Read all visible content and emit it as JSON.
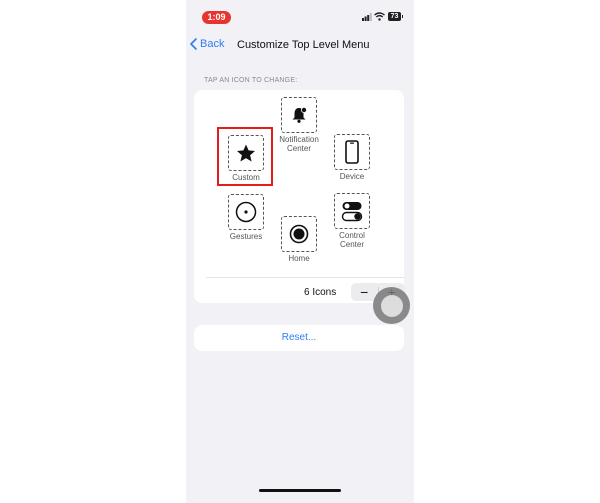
{
  "status_bar": {
    "time": "1:09",
    "battery": "73"
  },
  "nav": {
    "back_label": "Back",
    "title": "Customize Top Level Menu"
  },
  "section": {
    "header": "TAP AN ICON TO CHANGE:"
  },
  "icons": [
    {
      "label": "Notification\nCenter",
      "icon": "bell-icon"
    },
    {
      "label": "Custom",
      "icon": "star-icon"
    },
    {
      "label": "Device",
      "icon": "phone-device-icon"
    },
    {
      "label": "Gestures",
      "icon": "gestures-circle-icon"
    },
    {
      "label": "Home",
      "icon": "home-button-icon"
    },
    {
      "label": "Control\nCenter",
      "icon": "toggles-icon"
    }
  ],
  "count": {
    "label": "6 Icons",
    "minus": "−",
    "plus": "+"
  },
  "reset": {
    "label": "Reset..."
  },
  "colors": {
    "accent": "#2f7bf5",
    "highlight": "#e31d1d",
    "time_pill": "#e8342e"
  }
}
